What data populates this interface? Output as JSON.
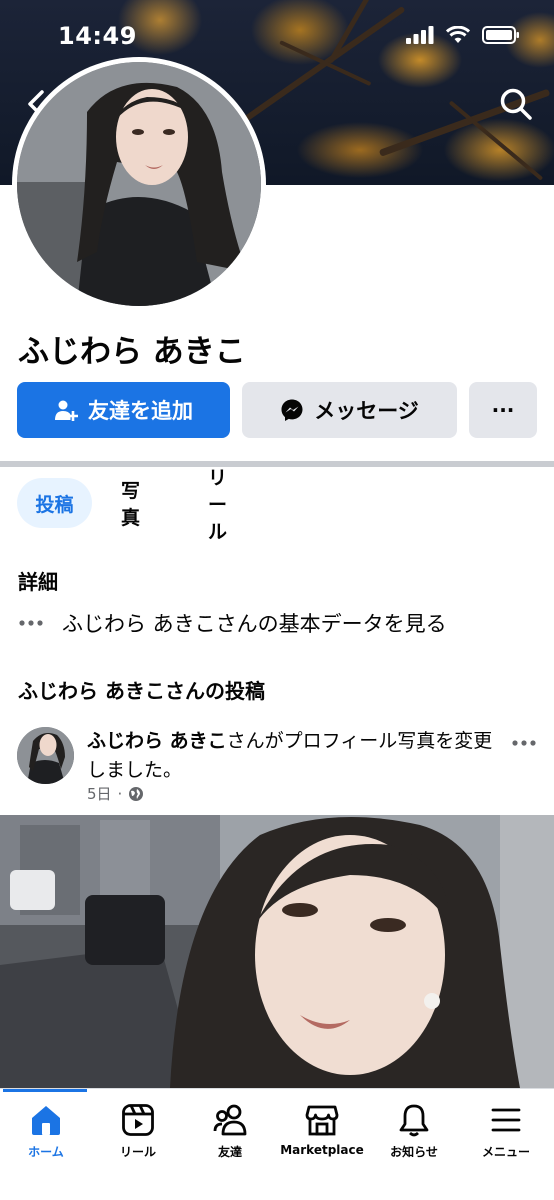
{
  "status_bar": {
    "time": "14:49"
  },
  "profile": {
    "name": "ふじわら あきこ",
    "add_friend_label": "友達を追加",
    "message_label": "メッセージ",
    "more_label": "···"
  },
  "tabs": [
    {
      "label": "投稿",
      "active": true
    },
    {
      "label": "写真",
      "active": false
    },
    {
      "label": "リール",
      "active": false
    }
  ],
  "details": {
    "title": "詳細",
    "view_basic_info": "ふじわら あきこさんの基本データを見る"
  },
  "posts_section": {
    "title": "ふじわら あきこさんの投稿",
    "post": {
      "author": "ふじわら あきこ",
      "action": "さんがプロフィール写真を変更しました。",
      "time": "5日",
      "separator": "·",
      "audience_icon": "globe-icon"
    }
  },
  "bottom_nav": [
    {
      "label": "ホーム",
      "icon": "home-icon",
      "active": true
    },
    {
      "label": "リール",
      "icon": "reels-icon",
      "active": false
    },
    {
      "label": "友達",
      "icon": "friends-icon",
      "active": false
    },
    {
      "label": "Marketplace",
      "icon": "marketplace-icon",
      "active": false
    },
    {
      "label": "お知らせ",
      "icon": "bell-icon",
      "active": false
    },
    {
      "label": "メニュー",
      "icon": "menu-icon",
      "active": false
    }
  ],
  "colors": {
    "accent": "#1b74e4",
    "button_gray": "#e4e6eb",
    "meta_gray": "#65676b"
  }
}
